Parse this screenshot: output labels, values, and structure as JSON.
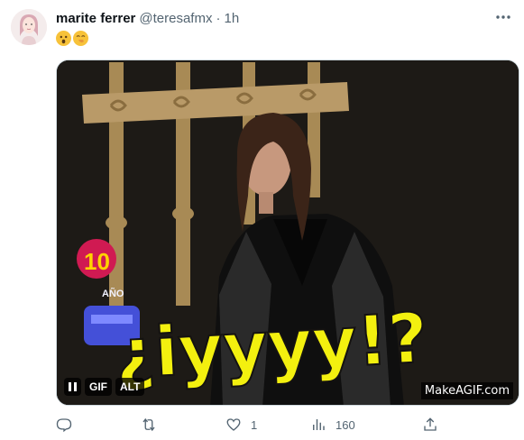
{
  "tweet": {
    "author_name": "marite ferrer",
    "handle": "@teresafmx",
    "separator": "·",
    "time": "1h",
    "emojis": [
      "astonished-face",
      "face-with-hand-over-mouth"
    ]
  },
  "media": {
    "caption_text": "¿iyyyy!?",
    "watermark": "MakeAGIF.com",
    "badge_10": "10",
    "badge_sub": "AÑO",
    "controls": {
      "pause": "pause",
      "gif_label": "GIF",
      "alt_label": "ALT"
    }
  },
  "actions": {
    "replies": "",
    "retweets": "",
    "likes": "1",
    "views": "160"
  },
  "colors": {
    "text_primary": "#0f1419",
    "text_secondary": "#536471",
    "caption_yellow": "#f3f00f",
    "border": "#cfd9de"
  }
}
